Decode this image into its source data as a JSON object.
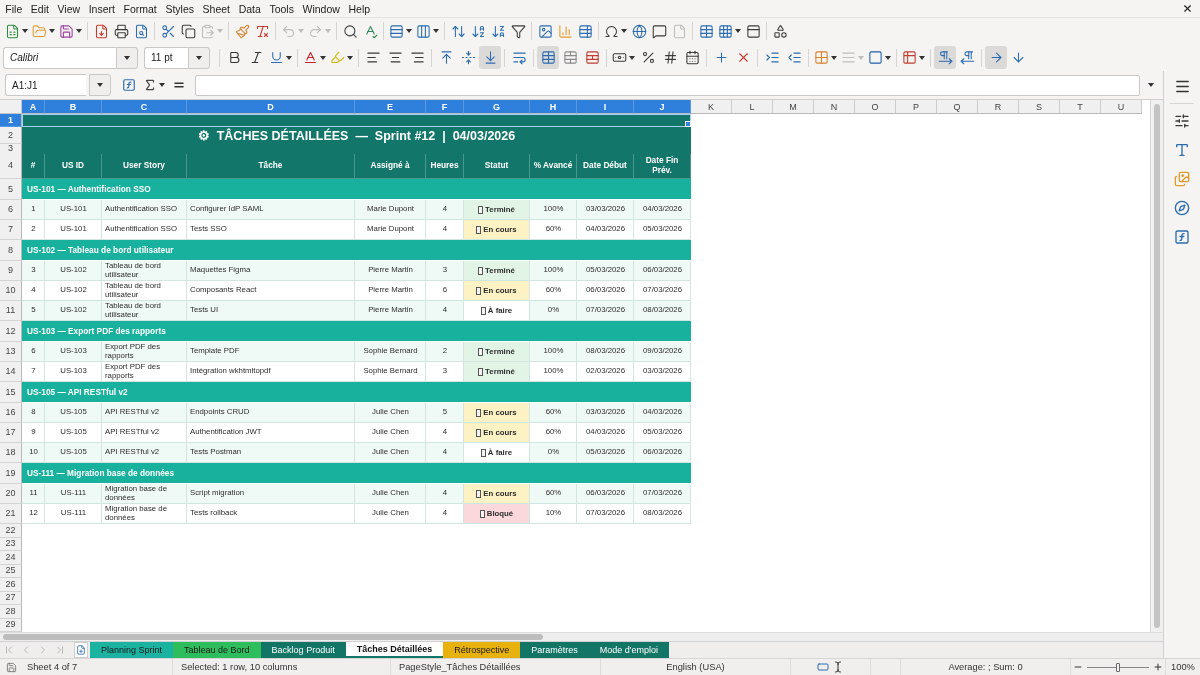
{
  "menu_bar": {
    "items": [
      "File",
      "Edit",
      "View",
      "Insert",
      "Format",
      "Styles",
      "Sheet",
      "Data",
      "Tools",
      "Window",
      "Help"
    ]
  },
  "standard_toolbar": {
    "groups": [
      [
        {
          "kind": "new",
          "disabled": false
        },
        {
          "kind": "open",
          "disabled": false
        },
        {
          "kind": "save",
          "disabled": false
        }
      ],
      [
        {
          "kind": "pdf",
          "disabled": false
        },
        {
          "kind": "print",
          "disabled": false
        },
        {
          "kind": "preview",
          "disabled": false
        }
      ],
      [
        {
          "kind": "cut",
          "disabled": false
        },
        {
          "kind": "copy",
          "disabled": false
        },
        {
          "kind": "paste",
          "disabled": true
        }
      ],
      [
        {
          "kind": "clone",
          "disabled": false
        },
        {
          "kind": "clearformat",
          "disabled": false
        }
      ],
      [
        {
          "kind": "undo",
          "disabled": true
        },
        {
          "kind": "redo",
          "disabled": true
        }
      ],
      [
        {
          "kind": "find",
          "disabled": false
        },
        {
          "kind": "spelling",
          "disabled": false
        }
      ],
      [
        {
          "kind": "rows",
          "disabled": false
        },
        {
          "kind": "columns",
          "disabled": false
        }
      ],
      [
        {
          "kind": "sort",
          "disabled": false
        },
        {
          "kind": "sortup",
          "disabled": false
        },
        {
          "kind": "sortdown",
          "disabled": false
        },
        {
          "kind": "filter",
          "disabled": false
        }
      ],
      [
        {
          "kind": "image",
          "disabled": false
        },
        {
          "kind": "chart",
          "disabled": false
        },
        {
          "kind": "pivot",
          "disabled": false
        }
      ],
      [
        {
          "kind": "special",
          "disabled": false
        },
        {
          "kind": "hyperlink",
          "disabled": false
        },
        {
          "kind": "comment",
          "disabled": false
        },
        {
          "kind": "headerfooter",
          "disabled": true
        }
      ],
      [
        {
          "kind": "printarea",
          "disabled": false
        },
        {
          "kind": "freeze",
          "disabled": false
        },
        {
          "kind": "split",
          "disabled": false
        }
      ],
      [
        {
          "kind": "shapes",
          "disabled": false
        }
      ]
    ]
  },
  "formatting_toolbar": {
    "font_name": "Calibri",
    "font_size": "11 pt",
    "groups": [
      [
        {
          "kind": "bold",
          "pressed": false,
          "disabled": false
        },
        {
          "kind": "italic",
          "pressed": false,
          "disabled": false
        },
        {
          "kind": "underline",
          "pressed": false,
          "disabled": false
        }
      ],
      [
        {
          "kind": "fontcolor",
          "pressed": false,
          "disabled": false
        },
        {
          "kind": "highlight",
          "pressed": false,
          "disabled": false
        }
      ],
      [
        {
          "kind": "left",
          "pressed": false,
          "disabled": false
        },
        {
          "kind": "center",
          "pressed": false,
          "disabled": false
        },
        {
          "kind": "right",
          "pressed": false,
          "disabled": false
        }
      ],
      [
        {
          "kind": "top",
          "pressed": false,
          "disabled": false
        },
        {
          "kind": "middle",
          "pressed": false,
          "disabled": false
        },
        {
          "kind": "bottom",
          "pressed": true,
          "disabled": false
        }
      ],
      [
        {
          "kind": "wrap",
          "pressed": false,
          "disabled": false
        }
      ],
      [
        {
          "kind": "mergecenter",
          "pressed": true,
          "disabled": false
        },
        {
          "kind": "merge",
          "pressed": false,
          "disabled": false
        },
        {
          "kind": "unmerge",
          "pressed": false,
          "disabled": false
        }
      ],
      [
        {
          "kind": "currency",
          "pressed": false,
          "disabled": false
        },
        {
          "kind": "percent",
          "pressed": false,
          "disabled": false
        },
        {
          "kind": "number",
          "pressed": false,
          "disabled": false
        },
        {
          "kind": "date",
          "pressed": false,
          "disabled": false
        }
      ],
      [
        {
          "kind": "adddecimal",
          "pressed": false,
          "disabled": false
        },
        {
          "kind": "deldecimal",
          "pressed": false,
          "disabled": false
        }
      ],
      [
        {
          "kind": "indent",
          "pressed": false,
          "disabled": false
        },
        {
          "kind": "outdent",
          "pressed": false,
          "disabled": false
        }
      ],
      [
        {
          "kind": "borders",
          "pressed": false,
          "disabled": false
        },
        {
          "kind": "borderstyle",
          "pressed": false,
          "disabled": true
        },
        {
          "kind": "bordercolor",
          "pressed": false,
          "disabled": false
        }
      ],
      [
        {
          "kind": "conditional",
          "pressed": false,
          "disabled": false
        }
      ],
      [
        {
          "kind": "ltr",
          "pressed": true,
          "disabled": false
        },
        {
          "kind": "rtl",
          "pressed": false,
          "disabled": false
        }
      ],
      [
        {
          "kind": "horizontal",
          "pressed": true,
          "disabled": false
        },
        {
          "kind": "vertical",
          "pressed": false,
          "disabled": false
        }
      ]
    ]
  },
  "formula_bar": {
    "cell_reference": "A1:J1"
  },
  "sheet": {
    "columns": [
      {
        "label": "A",
        "selected": true
      },
      {
        "label": "B",
        "selected": true
      },
      {
        "label": "C",
        "selected": true
      },
      {
        "label": "D",
        "selected": true
      },
      {
        "label": "E",
        "selected": true
      },
      {
        "label": "F",
        "selected": true
      },
      {
        "label": "G",
        "selected": true
      },
      {
        "label": "H",
        "selected": true
      },
      {
        "label": "I",
        "selected": true
      },
      {
        "label": "J",
        "selected": true
      },
      {
        "label": "K",
        "selected": false
      },
      {
        "label": "L",
        "selected": false
      },
      {
        "label": "M",
        "selected": false
      },
      {
        "label": "N",
        "selected": false
      },
      {
        "label": "O",
        "selected": false
      },
      {
        "label": "P",
        "selected": false
      },
      {
        "label": "Q",
        "selected": false
      },
      {
        "label": "R",
        "selected": false
      },
      {
        "label": "S",
        "selected": false
      },
      {
        "label": "T",
        "selected": false
      },
      {
        "label": "U",
        "selected": false
      }
    ],
    "rows": [
      {
        "number": "1",
        "selected": true,
        "kind": "band"
      },
      {
        "number": "2",
        "selected": false,
        "kind": "title",
        "title": "⚙  TÂCHES DÉTAILLÉES  —  Sprint #12  |  04/03/2026"
      },
      {
        "number": "3",
        "selected": false,
        "kind": "spacer"
      },
      {
        "number": "4",
        "selected": false,
        "kind": "header",
        "cells": [
          "#",
          "US ID",
          "User Story",
          "Tâche",
          "Assigné à",
          "Heures",
          "Statut",
          "% Avancé",
          "Date Début",
          "Date Fin Prév."
        ]
      },
      {
        "number": "5",
        "selected": false,
        "kind": "group",
        "text": "US-101 — Authentification SSO"
      },
      {
        "number": "6",
        "selected": false,
        "kind": "task",
        "shaded": true,
        "color": "#e2f4e5",
        "cells": [
          "1",
          "US-101",
          "Authentification SSO",
          "Configurer IdP SAML",
          "Marie Dupont",
          "4",
          "Terminé",
          "100%",
          "03/03/2026",
          "04/03/2026"
        ]
      },
      {
        "number": "7",
        "selected": false,
        "kind": "task",
        "shaded": false,
        "color": "#fdf2c4",
        "cells": [
          "2",
          "US-101",
          "Authentification SSO",
          "Tests SSO",
          "Marie Dupont",
          "4",
          "En cours",
          "60%",
          "04/03/2026",
          "05/03/2026"
        ]
      },
      {
        "number": "8",
        "selected": false,
        "kind": "group",
        "text": "US-102 — Tableau de bord utilisateur"
      },
      {
        "number": "9",
        "selected": false,
        "kind": "task",
        "shaded": true,
        "color": "#e2f4e5",
        "cells": [
          "3",
          "US-102",
          "Tableau de bord utilisateur",
          "Maquettes Figma",
          "Pierre Martin",
          "3",
          "Terminé",
          "100%",
          "05/03/2026",
          "06/03/2026"
        ]
      },
      {
        "number": "10",
        "selected": false,
        "kind": "task",
        "shaded": false,
        "color": "#fdf2c4",
        "cells": [
          "4",
          "US-102",
          "Tableau de bord utilisateur",
          "Composants React",
          "Pierre Martin",
          "6",
          "En cours",
          "60%",
          "06/03/2026",
          "07/03/2026"
        ]
      },
      {
        "number": "11",
        "selected": false,
        "kind": "task",
        "shaded": true,
        "color": "#ffffff",
        "cells": [
          "5",
          "US-102",
          "Tableau de bord utilisateur",
          "Tests UI",
          "Pierre Martin",
          "4",
          "À faire",
          "0%",
          "07/03/2026",
          "08/03/2026"
        ]
      },
      {
        "number": "12",
        "selected": false,
        "kind": "group",
        "text": "US-103 — Export PDF des rapports"
      },
      {
        "number": "13",
        "selected": false,
        "kind": "task",
        "shaded": true,
        "color": "#e2f4e5",
        "cells": [
          "6",
          "US-103",
          "Export PDF des rapports",
          "Template PDF",
          "Sophie Bernard",
          "2",
          "Terminé",
          "100%",
          "08/03/2026",
          "09/03/2026"
        ]
      },
      {
        "number": "14",
        "selected": false,
        "kind": "task",
        "shaded": false,
        "color": "#e2f4e5",
        "cells": [
          "7",
          "US-103",
          "Export PDF des rapports",
          "Intégration wkhtmltopdf",
          "Sophie Bernard",
          "3",
          "Terminé",
          "100%",
          "02/03/2026",
          "03/03/2026"
        ]
      },
      {
        "number": "15",
        "selected": false,
        "kind": "group",
        "text": "US-105 — API RESTful v2"
      },
      {
        "number": "16",
        "selected": false,
        "kind": "task",
        "shaded": true,
        "color": "#fdf2c4",
        "cells": [
          "8",
          "US-105",
          "API RESTful v2",
          "Endpoints CRUD",
          "Julie Chen",
          "5",
          "En cours",
          "60%",
          "03/03/2026",
          "04/03/2026"
        ]
      },
      {
        "number": "17",
        "selected": false,
        "kind": "task",
        "shaded": false,
        "color": "#fdf2c4",
        "cells": [
          "9",
          "US-105",
          "API RESTful v2",
          "Authentification JWT",
          "Julie Chen",
          "4",
          "En cours",
          "60%",
          "04/03/2026",
          "05/03/2026"
        ]
      },
      {
        "number": "18",
        "selected": false,
        "kind": "task",
        "shaded": true,
        "color": "#ffffff",
        "cells": [
          "10",
          "US-105",
          "API RESTful v2",
          "Tests Postman",
          "Julie Chen",
          "4",
          "À faire",
          "0%",
          "05/03/2026",
          "06/03/2026"
        ]
      },
      {
        "number": "19",
        "selected": false,
        "kind": "group",
        "text": "US-111 — Migration base de données"
      },
      {
        "number": "20",
        "selected": false,
        "kind": "task",
        "shaded": true,
        "color": "#fdf2c4",
        "cells": [
          "11",
          "US-111",
          "Migration base de données",
          "Script migration",
          "Julie Chen",
          "4",
          "En cours",
          "60%",
          "06/03/2026",
          "07/03/2026"
        ]
      },
      {
        "number": "21",
        "selected": false,
        "kind": "task",
        "shaded": false,
        "color": "#fbd8db",
        "cells": [
          "12",
          "US-111",
          "Migration base de données",
          "Tests rollback",
          "Julie Chen",
          "4",
          "Bloqué",
          "10%",
          "07/03/2026",
          "08/03/2026"
        ]
      },
      {
        "number": "22",
        "selected": false,
        "kind": "blank"
      },
      {
        "number": "23",
        "selected": false,
        "kind": "blank"
      },
      {
        "number": "24",
        "selected": false,
        "kind": "blank"
      },
      {
        "number": "25",
        "selected": false,
        "kind": "blank"
      },
      {
        "number": "26",
        "selected": false,
        "kind": "blank"
      },
      {
        "number": "27",
        "selected": false,
        "kind": "blank"
      },
      {
        "number": "28",
        "selected": false,
        "kind": "blank"
      },
      {
        "number": "29",
        "selected": false,
        "kind": "blank"
      }
    ]
  },
  "sheet_tabs": {
    "navigation_disabled": true,
    "tabs": [
      {
        "label": "Planning Sprint",
        "selected": false,
        "color": "#1ab39f"
      },
      {
        "label": "Tableau de Bord",
        "selected": false,
        "color": "#2ebd5c"
      },
      {
        "label": "Backlog Produit",
        "selected": false,
        "color": "#137566"
      },
      {
        "label": "Tâches Détaillées",
        "selected": true
      },
      {
        "label": "Rétrospective",
        "selected": false,
        "color": "#e8b20e"
      },
      {
        "label": "Paramètres",
        "selected": false,
        "color": "#137566"
      },
      {
        "label": "Mode d'emploi",
        "selected": false,
        "color": "#137566"
      }
    ]
  },
  "status_bar": {
    "sheet_position": "Sheet 4 of 7",
    "selection": "Selected: 1 row, 10 columns",
    "page_style": "PageStyle_Tâches Détaillées",
    "language": "English (USA)",
    "summary": "Average: ; Sum: 0",
    "zoom": {
      "level": 0.5,
      "reading": "100%"
    }
  }
}
